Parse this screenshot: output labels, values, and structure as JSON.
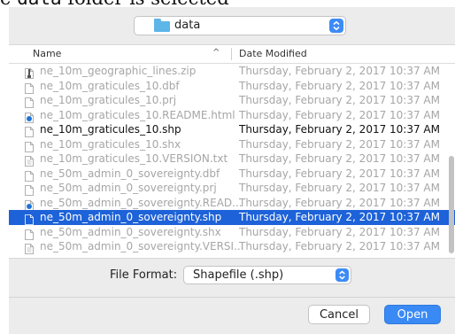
{
  "caption": {
    "prefix": "e ",
    "code": "data",
    "suffix": " folder is selected"
  },
  "folder": {
    "name": "data",
    "icon": "folder-icon"
  },
  "columns": {
    "name": "Name",
    "date": "Date Modified",
    "sort_indicator": "^"
  },
  "files": [
    {
      "name": "ne_10m_geographic_lines.zip",
      "date": "Thursday, February 2, 2017 10:37 AM",
      "icon": "zip-file-icon",
      "state": "disabled"
    },
    {
      "name": "ne_10m_graticules_10.dbf",
      "date": "Thursday, February 2, 2017 10:37 AM",
      "icon": "file-icon",
      "state": "disabled"
    },
    {
      "name": "ne_10m_graticules_10.prj",
      "date": "Thursday, February 2, 2017 10:37 AM",
      "icon": "file-icon",
      "state": "disabled"
    },
    {
      "name": "ne_10m_graticules_10.README.html",
      "date": "Thursday, February 2, 2017 10:37 AM",
      "icon": "html-file-icon",
      "state": "disabled"
    },
    {
      "name": "ne_10m_graticules_10.shp",
      "date": "Thursday, February 2, 2017 10:37 AM",
      "icon": "file-icon",
      "state": "enabled"
    },
    {
      "name": "ne_10m_graticules_10.shx",
      "date": "Thursday, February 2, 2017 10:37 AM",
      "icon": "file-icon",
      "state": "disabled"
    },
    {
      "name": "ne_10m_graticules_10.VERSION.txt",
      "date": "Thursday, February 2, 2017 10:37 AM",
      "icon": "text-file-icon",
      "state": "disabled"
    },
    {
      "name": "ne_50m_admin_0_sovereignty.dbf",
      "date": "Thursday, February 2, 2017 10:37 AM",
      "icon": "file-icon",
      "state": "disabled"
    },
    {
      "name": "ne_50m_admin_0_sovereignty.prj",
      "date": "Thursday, February 2, 2017 10:37 AM",
      "icon": "file-icon",
      "state": "disabled"
    },
    {
      "name": "ne_50m_admin_0_sovereignty.READ...",
      "date": "Thursday, February 2, 2017 10:37 AM",
      "icon": "html-file-icon",
      "state": "disabled"
    },
    {
      "name": "ne_50m_admin_0_sovereignty.shp",
      "date": "Thursday, February 2, 2017 10:37 AM",
      "icon": "file-icon",
      "state": "selected"
    },
    {
      "name": "ne_50m_admin_0_sovereignty.shx",
      "date": "Thursday, February 2, 2017 10:37 AM",
      "icon": "file-icon",
      "state": "disabled"
    },
    {
      "name": "ne_50m_admin_0_sovereignty.VERSI...",
      "date": "Thursday, February 2, 2017 10:37 AM",
      "icon": "text-file-icon",
      "state": "disabled"
    }
  ],
  "format": {
    "label": "File Format:",
    "value": "Shapefile (.shp)"
  },
  "buttons": {
    "cancel": "Cancel",
    "open": "Open"
  },
  "colors": {
    "accent": "#3a8af5",
    "selection": "#1d62d8",
    "disabled_text": "#a6a6a6",
    "folder": "#5db5e8"
  }
}
